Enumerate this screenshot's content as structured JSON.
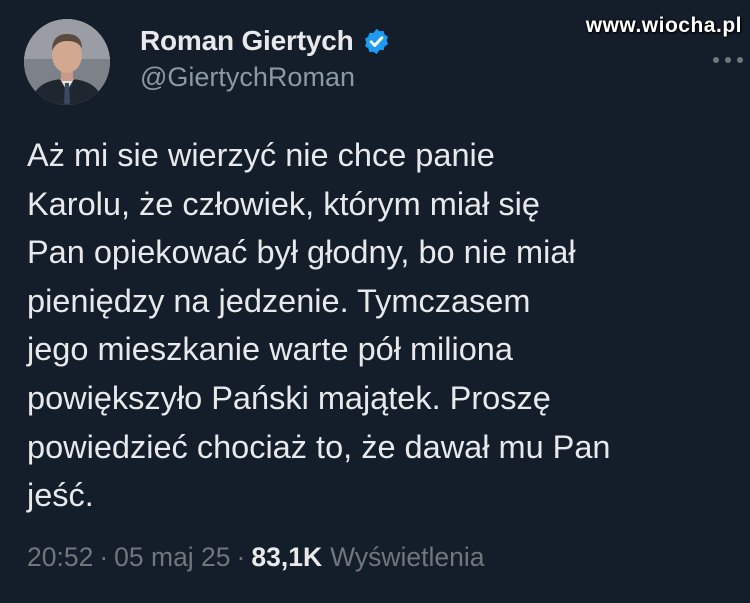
{
  "author": {
    "display_name": "Roman Giertych",
    "handle": "@GiertychRoman",
    "verified": true
  },
  "watermark": "www.wiocha.pl",
  "tweet": {
    "lines": [
      "Aż mi sie wierzyć nie chce panie",
      "Karolu, że człowiek, którym miał się",
      "Pan opiekować był głodny, bo nie miał",
      "pieniędzy na jedzenie. Tymczasem",
      "jego mieszkanie warte pół miliona",
      "powiększyło Pański majątek. Proszę",
      "powiedzieć chociaż to, że dawał mu Pan",
      "jeść."
    ]
  },
  "meta": {
    "time": "20:52",
    "separator": "·",
    "date": "05 maj 25",
    "views_count": "83,1K",
    "views_label": "Wyświetlenia"
  },
  "icons": {
    "verified": "verified-badge-icon",
    "more": "more-horizontal-icon"
  },
  "colors": {
    "background": "#141d2a",
    "text": "#e7e9ea",
    "secondary_text": "#71767b",
    "handle_text": "#8b98a5",
    "verified_blue": "#1d9bf0"
  }
}
